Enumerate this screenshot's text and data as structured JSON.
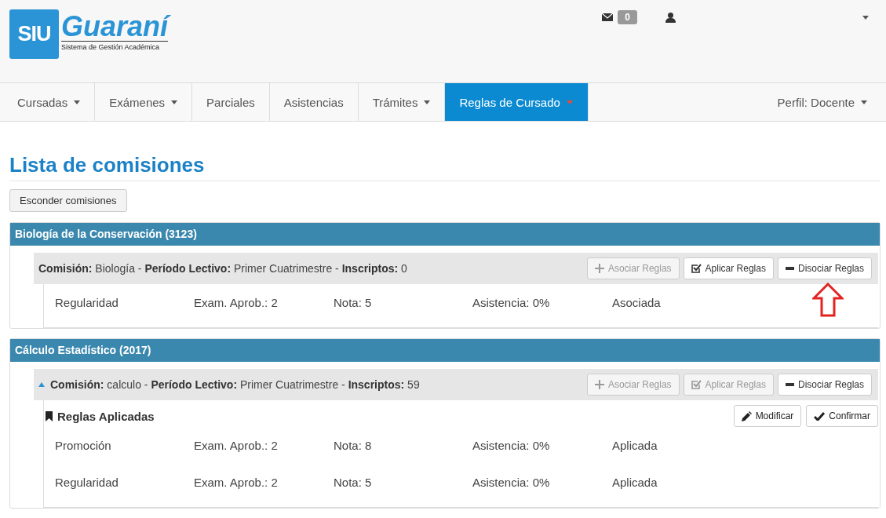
{
  "logo": {
    "mark": "SIU",
    "name": "Guaraní",
    "subtitle": "Sistema de Gestión Académica"
  },
  "top_bar": {
    "message_count": "0"
  },
  "nav": {
    "items": [
      {
        "label": "Cursadas",
        "dropdown": true,
        "selected": false
      },
      {
        "label": "Exámenes",
        "dropdown": true,
        "selected": false
      },
      {
        "label": "Parciales",
        "dropdown": false,
        "selected": false
      },
      {
        "label": "Asistencias",
        "dropdown": false,
        "selected": false
      },
      {
        "label": "Trámites",
        "dropdown": true,
        "selected": false
      },
      {
        "label": "Reglas de Cursado",
        "dropdown": true,
        "selected": true
      }
    ],
    "profile": "Perfil: Docente"
  },
  "page_title": "Lista de comisiones",
  "hide_button": "Esconder comisiones",
  "subjects": [
    {
      "title": "Biología de la Conservación (3123)",
      "commissions": [
        {
          "header": "**Comisión:** Biología - **Período Lectivo:** Primer Cuatrimestre - **Inscriptos:** 0",
          "expanded": false,
          "buttons": [
            {
              "kind": "plus",
              "label": "Asociar Reglas",
              "disabled": true
            },
            {
              "kind": "check",
              "label": "Aplicar Reglas",
              "disabled": false
            },
            {
              "kind": "minus",
              "label": "Disociar Reglas",
              "disabled": false
            }
          ],
          "rules": [
            {
              "name": "Regularidad",
              "exams": "Exam. Aprob.: 2",
              "grade": "Nota: 5",
              "attendance": "Asistencia: 0%",
              "status": "Asociada"
            }
          ]
        }
      ]
    },
    {
      "title": "Cálculo Estadístico (2017)",
      "commissions": [
        {
          "header": "**Comisión:** calculo - **Período Lectivo:** Primer Cuatrimestre - **Inscriptos:** 59",
          "expanded": true,
          "buttons": [
            {
              "kind": "plus",
              "label": "Asociar Reglas",
              "disabled": true
            },
            {
              "kind": "check",
              "label": "Aplicar Reglas",
              "disabled": true
            },
            {
              "kind": "minus",
              "label": "Disociar Reglas",
              "disabled": false
            }
          ],
          "rules_heading": {
            "title": "Reglas Aplicadas",
            "buttons": [
              {
                "kind": "pencil",
                "label": "Modificar"
              },
              {
                "kind": "tick",
                "label": "Confirmar"
              }
            ]
          },
          "rules": [
            {
              "name": "Promoción",
              "exams": "Exam. Aprob.: 2",
              "grade": "Nota: 8",
              "attendance": "Asistencia: 0%",
              "status": "Aplicada"
            },
            {
              "name": "Regularidad",
              "exams": "Exam. Aprob.: 2",
              "grade": "Nota: 5",
              "attendance": "Asistencia: 0%",
              "status": "Aplicada"
            }
          ]
        }
      ]
    }
  ]
}
